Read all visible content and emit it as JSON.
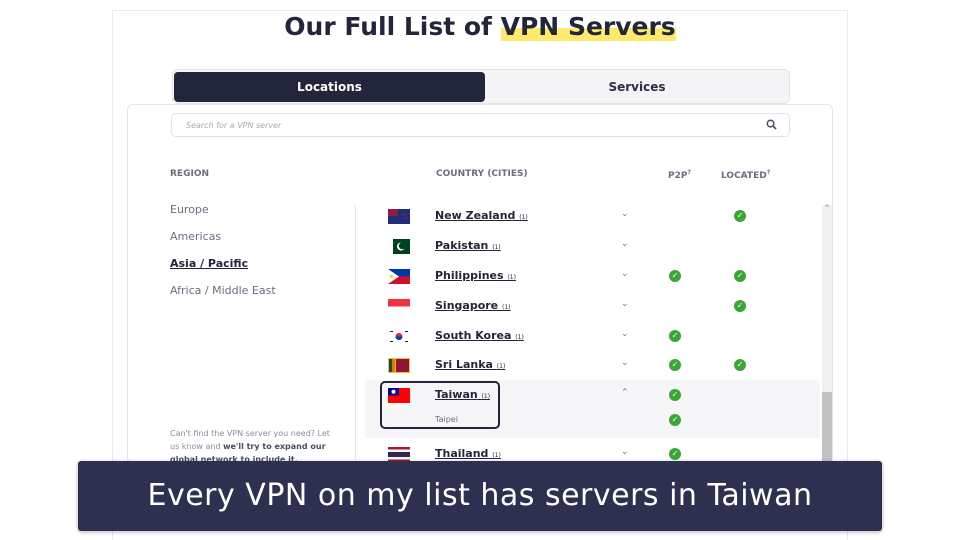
{
  "title_prefix": "Our Full List of ",
  "title_highlight": "VPN Servers",
  "tabs": [
    {
      "label": "Locations",
      "active": true
    },
    {
      "label": "Services",
      "active": false
    }
  ],
  "search": {
    "placeholder": "Search for a VPN server",
    "icon": "search-icon"
  },
  "headers": {
    "region": "REGION",
    "country": "COUNTRY (CITIES)",
    "p2p": "P2P",
    "located": "LOCATED",
    "help_mark": "?"
  },
  "regions": [
    {
      "label": "Europe"
    },
    {
      "label": "Americas"
    },
    {
      "label": "Asia / Pacific",
      "active": true
    },
    {
      "label": "Africa / Middle East"
    }
  ],
  "help": {
    "text1": "Can't find the VPN server you need? Let us know and ",
    "bold": "we'll try to expand our global network to include it."
  },
  "countries": [
    {
      "name": "New Zealand",
      "count": "(1)",
      "p2p": false,
      "located": true,
      "expanded": false
    },
    {
      "name": "Pakistan",
      "count": "(1)",
      "p2p": false,
      "located": false,
      "expanded": false
    },
    {
      "name": "Philippines",
      "count": "(1)",
      "p2p": true,
      "located": true,
      "expanded": false
    },
    {
      "name": "Singapore",
      "count": "(1)",
      "p2p": false,
      "located": true,
      "expanded": false
    },
    {
      "name": "South Korea",
      "count": "(1)",
      "p2p": true,
      "located": false,
      "expanded": false
    },
    {
      "name": "Sri Lanka",
      "count": "(1)",
      "p2p": true,
      "located": true,
      "expanded": false
    },
    {
      "name": "Taiwan",
      "count": "(1)",
      "p2p": true,
      "located": false,
      "expanded": true,
      "cities": [
        {
          "name": "Taipei",
          "p2p": true
        }
      ]
    },
    {
      "name": "Thailand",
      "count": "(1)",
      "p2p": true,
      "located": false,
      "expanded": false
    }
  ],
  "caption": "Every VPN on my list has servers in Taiwan",
  "colors": {
    "dark": "#23253a",
    "check": "#3aa635",
    "highlight": "#fde96b",
    "caption_bg": "#2e3050"
  }
}
